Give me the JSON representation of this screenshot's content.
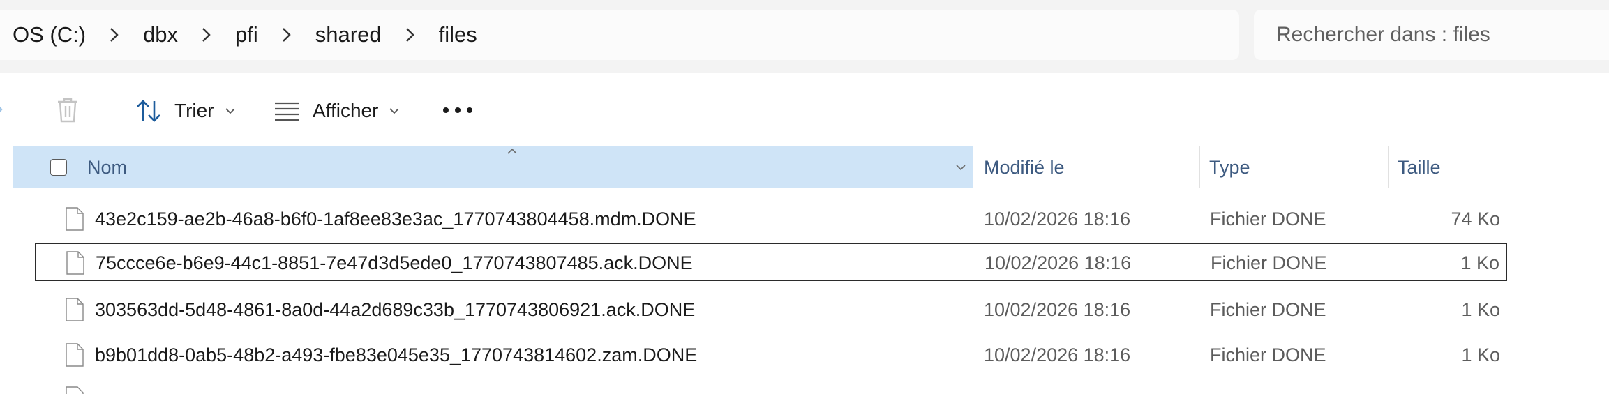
{
  "address": {
    "breadcrumbs": [
      "OS (C:)",
      "dbx",
      "pfi",
      "shared",
      "files"
    ]
  },
  "search": {
    "placeholder": "Rechercher dans : files"
  },
  "toolbar": {
    "sort_label": "Trier",
    "view_label": "Afficher",
    "delete_icon": "trash-icon",
    "more_icon": "ellipsis-icon"
  },
  "columns": {
    "name": "Nom",
    "modified": "Modifié le",
    "type": "Type",
    "size": "Taille"
  },
  "files": [
    {
      "name": "43e2c159-ae2b-46a8-b6f0-1af8ee83e3ac_1770743804458.mdm.DONE",
      "modified": "10/02/2026 18:16",
      "type": "Fichier DONE",
      "size": "74 Ko"
    },
    {
      "name": "75ccce6e-b6e9-44c1-8851-7e47d3d5ede0_1770743807485.ack.DONE",
      "modified": "10/02/2026 18:16",
      "type": "Fichier DONE",
      "size": "1 Ko"
    },
    {
      "name": "303563dd-5d48-4861-8a0d-44a2d689c33b_1770743806921.ack.DONE",
      "modified": "10/02/2026 18:16",
      "type": "Fichier DONE",
      "size": "1 Ko"
    },
    {
      "name": "b9b01dd8-0ab5-48b2-a493-fbe83e045e35_1770743814602.zam.DONE",
      "modified": "10/02/2026 18:16",
      "type": "Fichier DONE",
      "size": "1 Ko"
    }
  ],
  "colors": {
    "header_selected_bg": "#cfe4f7",
    "header_text": "#3d5a80",
    "accent": "#0067c0"
  }
}
